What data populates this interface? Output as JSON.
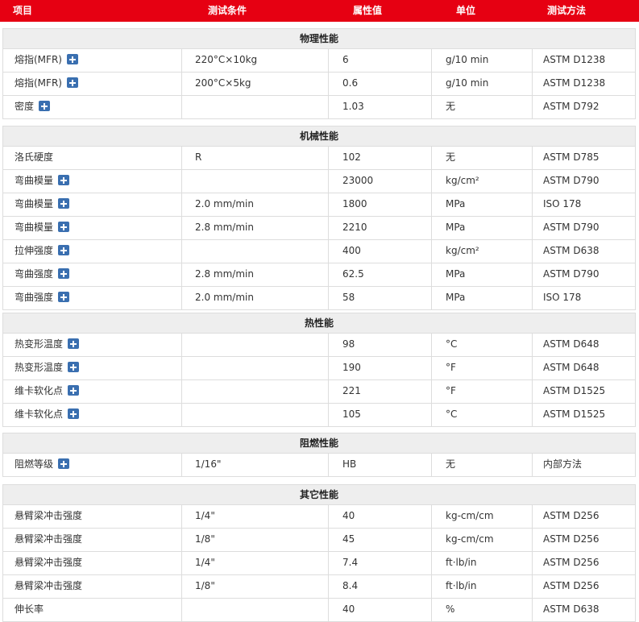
{
  "header": {
    "col_item": "项目",
    "col_condition": "测试条件",
    "col_value": "属性值",
    "col_unit": "单位",
    "col_method": "测试方法"
  },
  "sections": [
    {
      "title": "物理性能",
      "rows": [
        {
          "item": "熔指(MFR)",
          "condition": "220°C×10kg",
          "value": "6",
          "unit": "g/10 min",
          "method": "ASTM D1238",
          "icon": "plus-icon"
        },
        {
          "item": "熔指(MFR)",
          "condition": "200°C×5kg",
          "value": "0.6",
          "unit": "g/10 min",
          "method": "ASTM D1238",
          "icon": "plus-icon"
        },
        {
          "item": "密度",
          "condition": "",
          "value": "1.03",
          "unit": "无",
          "method": "ASTM D792",
          "icon": "plus-icon"
        }
      ]
    },
    {
      "title": "机械性能",
      "rows": [
        {
          "item": "洛氏硬度",
          "condition": "R",
          "value": "102",
          "unit": "无",
          "method": "ASTM D785",
          "icon": ""
        },
        {
          "item": "弯曲模量",
          "condition": "",
          "value": "23000",
          "unit": "kg/cm²",
          "method": "ASTM D790",
          "icon": "plus-icon"
        },
        {
          "item": "弯曲模量",
          "condition": "2.0 mm/min",
          "value": "1800",
          "unit": "MPa",
          "method": "ISO 178",
          "icon": "plus-icon"
        },
        {
          "item": "弯曲模量",
          "condition": "2.8 mm/min",
          "value": "2210",
          "unit": "MPa",
          "method": "ASTM D790",
          "icon": "plus-icon"
        },
        {
          "item": "拉伸强度",
          "condition": "",
          "value": "400",
          "unit": "kg/cm²",
          "method": "ASTM D638",
          "icon": "plus-icon"
        },
        {
          "item": "弯曲强度",
          "condition": "2.8 mm/min",
          "value": "62.5",
          "unit": "MPa",
          "method": "ASTM D790",
          "icon": "plus-icon"
        },
        {
          "item": "弯曲强度",
          "condition": "2.0 mm/min",
          "value": "58",
          "unit": "MPa",
          "method": "ISO 178",
          "icon": "plus-icon"
        }
      ]
    },
    {
      "title": "热性能",
      "rows": [
        {
          "item": "热变形温度",
          "condition": "",
          "value": "98",
          "unit": "°C",
          "method": "ASTM D648",
          "icon": "plus-icon"
        },
        {
          "item": "热变形温度",
          "condition": "",
          "value": "190",
          "unit": "°F",
          "method": "ASTM D648",
          "icon": "plus-icon"
        },
        {
          "item": "维卡软化点",
          "condition": "",
          "value": "221",
          "unit": "°F",
          "method": "ASTM D1525",
          "icon": "plus-icon"
        },
        {
          "item": "维卡软化点",
          "condition": "",
          "value": "105",
          "unit": "°C",
          "method": "ASTM D1525",
          "icon": "plus-icon"
        }
      ]
    },
    {
      "title": "阻燃性能",
      "rows": [
        {
          "item": "阻燃等级",
          "condition": "1/16\"",
          "value": "HB",
          "unit": "无",
          "method": "内部方法",
          "icon": "plus-icon"
        }
      ]
    },
    {
      "title": "其它性能",
      "rows": [
        {
          "item": "悬臂梁冲击强度",
          "condition": "1/4\"",
          "value": "40",
          "unit": "kg-cm/cm",
          "method": "ASTM D256",
          "icon": ""
        },
        {
          "item": "悬臂梁冲击强度",
          "condition": "1/8\"",
          "value": "45",
          "unit": "kg-cm/cm",
          "method": "ASTM D256",
          "icon": ""
        },
        {
          "item": "悬臂梁冲击强度",
          "condition": "1/4\"",
          "value": "7.4",
          "unit": "ft·lb/in",
          "method": "ASTM D256",
          "icon": ""
        },
        {
          "item": "悬臂梁冲击强度",
          "condition": "1/8\"",
          "value": "8.4",
          "unit": "ft·lb/in",
          "method": "ASTM D256",
          "icon": ""
        },
        {
          "item": "伸长率",
          "condition": "",
          "value": "40",
          "unit": "%",
          "method": "ASTM D638",
          "icon": ""
        }
      ]
    }
  ],
  "colors": {
    "header_bg": "#e60012",
    "section_bg": "#eeeeee",
    "icon_bg": "#3a6fb0",
    "border": "#dddddd"
  }
}
